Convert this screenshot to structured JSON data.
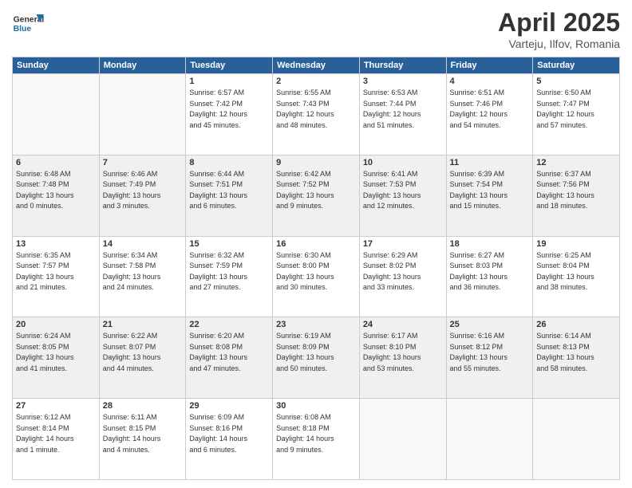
{
  "header": {
    "logo_general": "General",
    "logo_blue": "Blue",
    "title": "April 2025",
    "subtitle": "Varteju, Ilfov, Romania"
  },
  "columns": [
    "Sunday",
    "Monday",
    "Tuesday",
    "Wednesday",
    "Thursday",
    "Friday",
    "Saturday"
  ],
  "weeks": [
    {
      "days": [
        {
          "num": "",
          "detail": ""
        },
        {
          "num": "",
          "detail": ""
        },
        {
          "num": "1",
          "detail": "Sunrise: 6:57 AM\nSunset: 7:42 PM\nDaylight: 12 hours\nand 45 minutes."
        },
        {
          "num": "2",
          "detail": "Sunrise: 6:55 AM\nSunset: 7:43 PM\nDaylight: 12 hours\nand 48 minutes."
        },
        {
          "num": "3",
          "detail": "Sunrise: 6:53 AM\nSunset: 7:44 PM\nDaylight: 12 hours\nand 51 minutes."
        },
        {
          "num": "4",
          "detail": "Sunrise: 6:51 AM\nSunset: 7:46 PM\nDaylight: 12 hours\nand 54 minutes."
        },
        {
          "num": "5",
          "detail": "Sunrise: 6:50 AM\nSunset: 7:47 PM\nDaylight: 12 hours\nand 57 minutes."
        }
      ]
    },
    {
      "days": [
        {
          "num": "6",
          "detail": "Sunrise: 6:48 AM\nSunset: 7:48 PM\nDaylight: 13 hours\nand 0 minutes."
        },
        {
          "num": "7",
          "detail": "Sunrise: 6:46 AM\nSunset: 7:49 PM\nDaylight: 13 hours\nand 3 minutes."
        },
        {
          "num": "8",
          "detail": "Sunrise: 6:44 AM\nSunset: 7:51 PM\nDaylight: 13 hours\nand 6 minutes."
        },
        {
          "num": "9",
          "detail": "Sunrise: 6:42 AM\nSunset: 7:52 PM\nDaylight: 13 hours\nand 9 minutes."
        },
        {
          "num": "10",
          "detail": "Sunrise: 6:41 AM\nSunset: 7:53 PM\nDaylight: 13 hours\nand 12 minutes."
        },
        {
          "num": "11",
          "detail": "Sunrise: 6:39 AM\nSunset: 7:54 PM\nDaylight: 13 hours\nand 15 minutes."
        },
        {
          "num": "12",
          "detail": "Sunrise: 6:37 AM\nSunset: 7:56 PM\nDaylight: 13 hours\nand 18 minutes."
        }
      ]
    },
    {
      "days": [
        {
          "num": "13",
          "detail": "Sunrise: 6:35 AM\nSunset: 7:57 PM\nDaylight: 13 hours\nand 21 minutes."
        },
        {
          "num": "14",
          "detail": "Sunrise: 6:34 AM\nSunset: 7:58 PM\nDaylight: 13 hours\nand 24 minutes."
        },
        {
          "num": "15",
          "detail": "Sunrise: 6:32 AM\nSunset: 7:59 PM\nDaylight: 13 hours\nand 27 minutes."
        },
        {
          "num": "16",
          "detail": "Sunrise: 6:30 AM\nSunset: 8:00 PM\nDaylight: 13 hours\nand 30 minutes."
        },
        {
          "num": "17",
          "detail": "Sunrise: 6:29 AM\nSunset: 8:02 PM\nDaylight: 13 hours\nand 33 minutes."
        },
        {
          "num": "18",
          "detail": "Sunrise: 6:27 AM\nSunset: 8:03 PM\nDaylight: 13 hours\nand 36 minutes."
        },
        {
          "num": "19",
          "detail": "Sunrise: 6:25 AM\nSunset: 8:04 PM\nDaylight: 13 hours\nand 38 minutes."
        }
      ]
    },
    {
      "days": [
        {
          "num": "20",
          "detail": "Sunrise: 6:24 AM\nSunset: 8:05 PM\nDaylight: 13 hours\nand 41 minutes."
        },
        {
          "num": "21",
          "detail": "Sunrise: 6:22 AM\nSunset: 8:07 PM\nDaylight: 13 hours\nand 44 minutes."
        },
        {
          "num": "22",
          "detail": "Sunrise: 6:20 AM\nSunset: 8:08 PM\nDaylight: 13 hours\nand 47 minutes."
        },
        {
          "num": "23",
          "detail": "Sunrise: 6:19 AM\nSunset: 8:09 PM\nDaylight: 13 hours\nand 50 minutes."
        },
        {
          "num": "24",
          "detail": "Sunrise: 6:17 AM\nSunset: 8:10 PM\nDaylight: 13 hours\nand 53 minutes."
        },
        {
          "num": "25",
          "detail": "Sunrise: 6:16 AM\nSunset: 8:12 PM\nDaylight: 13 hours\nand 55 minutes."
        },
        {
          "num": "26",
          "detail": "Sunrise: 6:14 AM\nSunset: 8:13 PM\nDaylight: 13 hours\nand 58 minutes."
        }
      ]
    },
    {
      "days": [
        {
          "num": "27",
          "detail": "Sunrise: 6:12 AM\nSunset: 8:14 PM\nDaylight: 14 hours\nand 1 minute."
        },
        {
          "num": "28",
          "detail": "Sunrise: 6:11 AM\nSunset: 8:15 PM\nDaylight: 14 hours\nand 4 minutes."
        },
        {
          "num": "29",
          "detail": "Sunrise: 6:09 AM\nSunset: 8:16 PM\nDaylight: 14 hours\nand 6 minutes."
        },
        {
          "num": "30",
          "detail": "Sunrise: 6:08 AM\nSunset: 8:18 PM\nDaylight: 14 hours\nand 9 minutes."
        },
        {
          "num": "",
          "detail": ""
        },
        {
          "num": "",
          "detail": ""
        },
        {
          "num": "",
          "detail": ""
        }
      ]
    }
  ]
}
